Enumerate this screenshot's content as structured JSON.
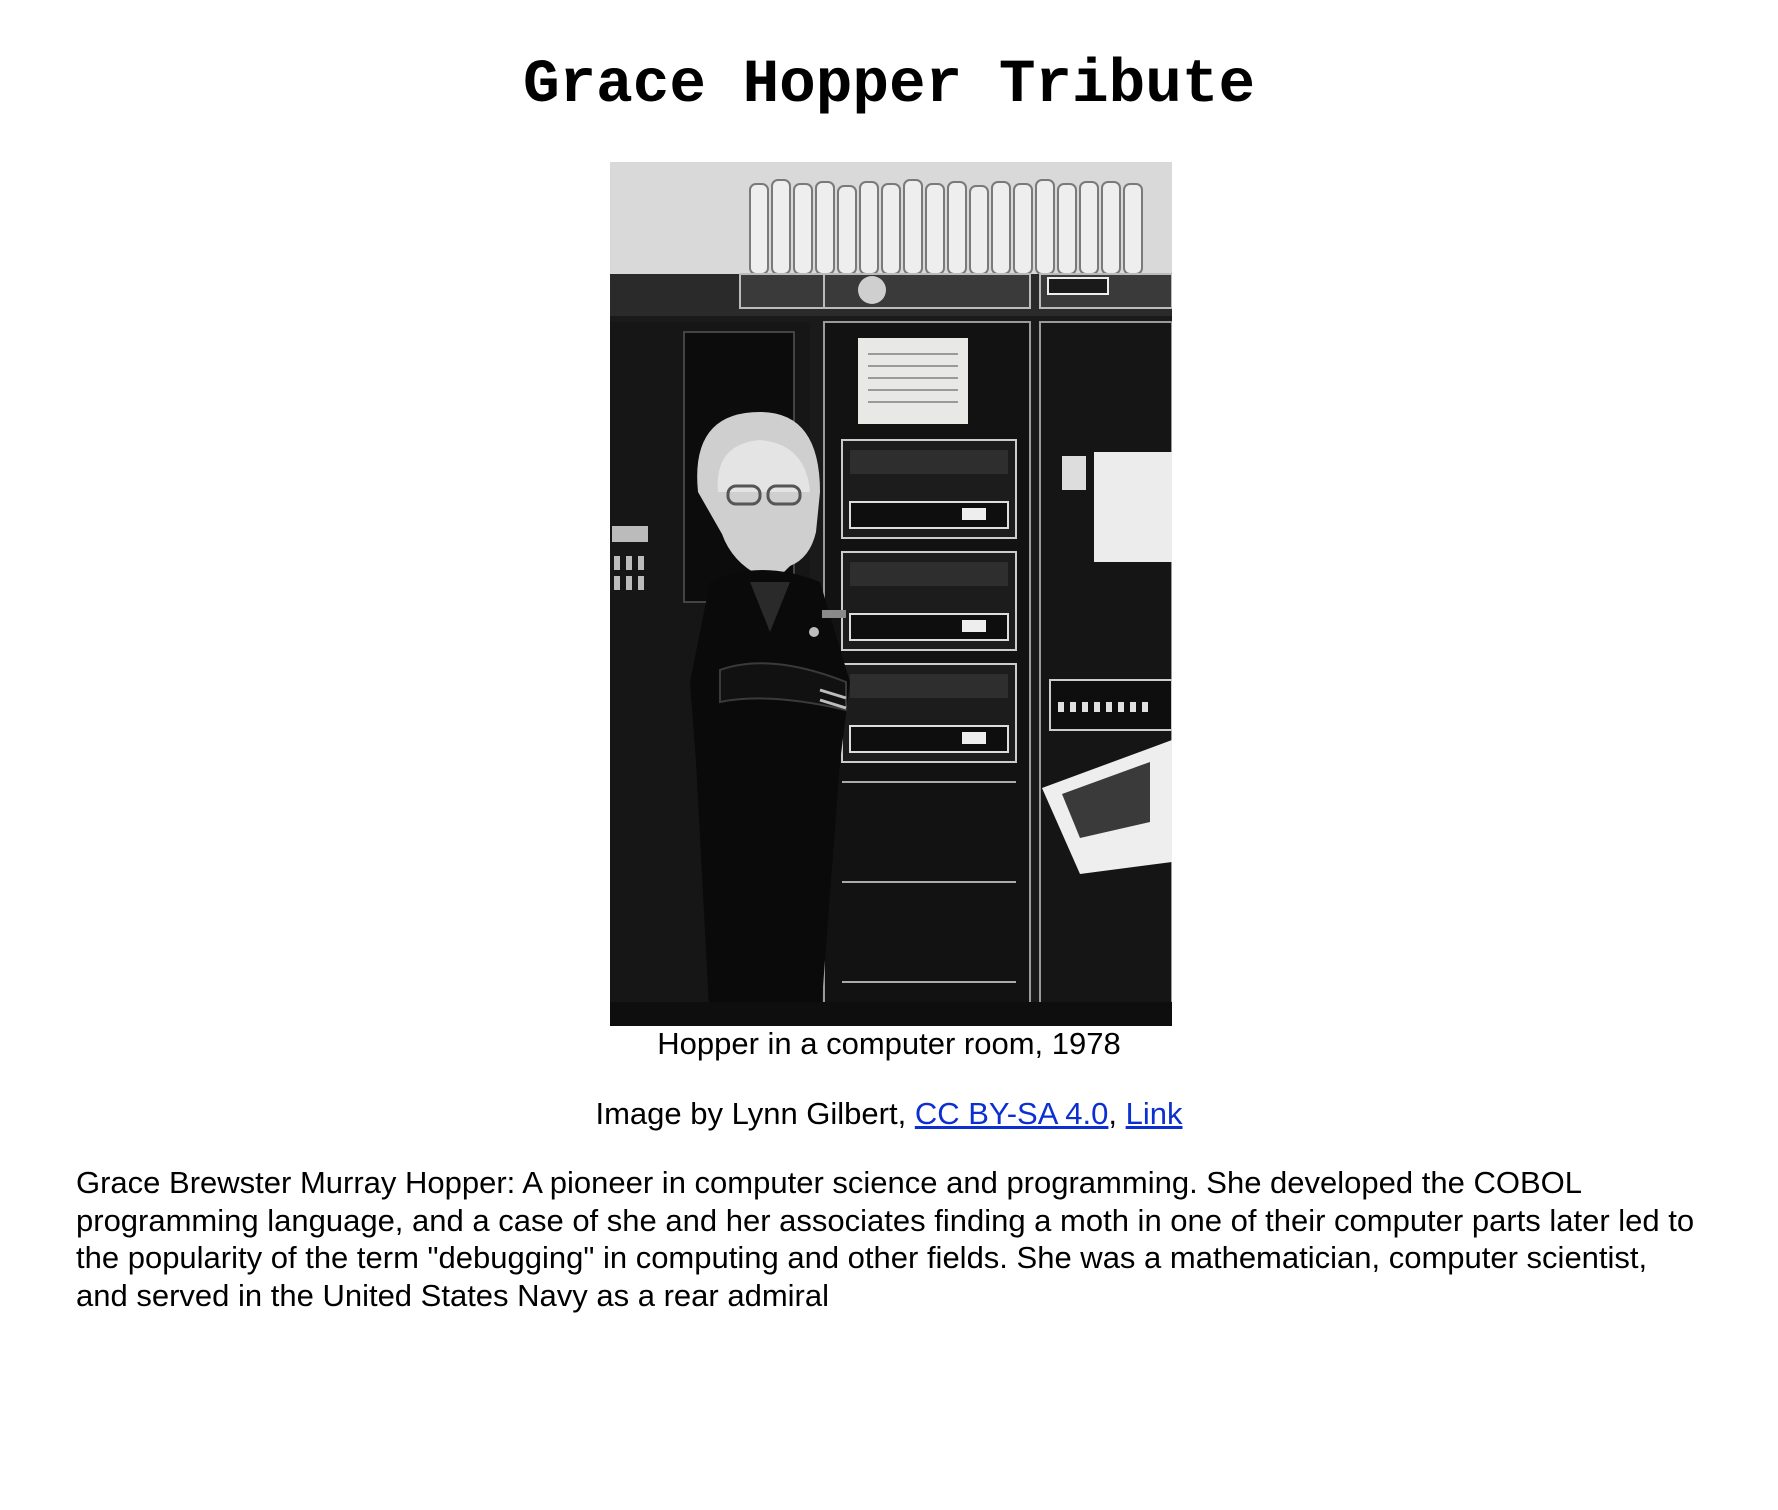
{
  "page": {
    "title": "Grace Hopper Tribute"
  },
  "figure": {
    "photo_icon": "grace-hopper-portrait-photo",
    "caption": "Hopper in a computer room, 1978"
  },
  "credit": {
    "prefix": "Image by Lynn Gilbert, ",
    "license_link": "CC BY-SA 4.0",
    "separator": ", ",
    "source_link": "Link"
  },
  "bio": {
    "text": "Grace Brewster Murray Hopper: A pioneer in computer science and programming. She developed the COBOL programming language, and a case of she and her associates finding a moth in one of their computer parts later led to the popularity of the term \"debugging\" in computing and other fields. She was a mathematician, computer scientist, and served in the United States Navy as a rear admiral"
  },
  "colors": {
    "link": "#0b2fd1",
    "text": "#000000",
    "background": "#ffffff"
  }
}
